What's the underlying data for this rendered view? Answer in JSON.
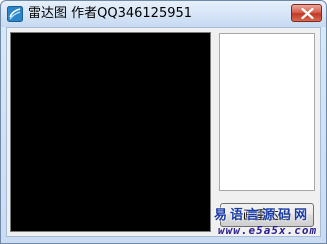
{
  "window": {
    "title": "雷达图 作者QQ346125951",
    "icon": "app-icon"
  },
  "controls": {
    "close_icon": "close-icon",
    "draw_button_label": "画雷达图"
  },
  "watermark": {
    "line1": "易语言源码网",
    "line2": "www.e5a5x.com"
  }
}
